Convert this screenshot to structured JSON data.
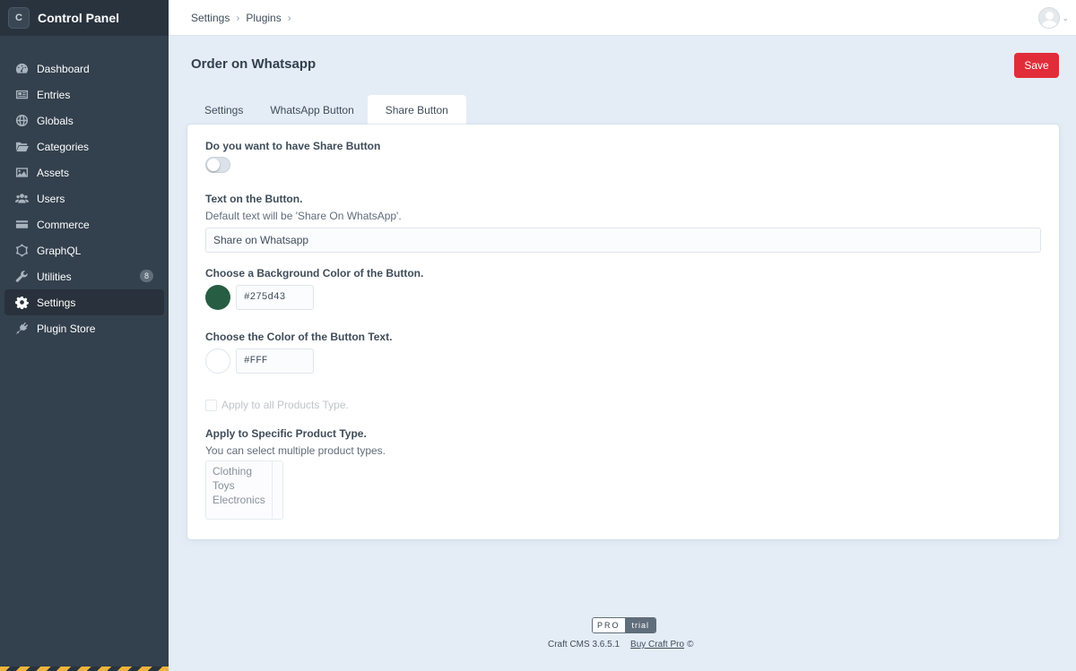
{
  "app": {
    "name": "Control Panel",
    "logo_letter": "C"
  },
  "nav": {
    "items": [
      {
        "label": "Dashboard",
        "icon": "gauge-icon"
      },
      {
        "label": "Entries",
        "icon": "newspaper-icon"
      },
      {
        "label": "Globals",
        "icon": "globe-icon"
      },
      {
        "label": "Categories",
        "icon": "folder-icon"
      },
      {
        "label": "Assets",
        "icon": "image-icon"
      },
      {
        "label": "Users",
        "icon": "users-icon"
      },
      {
        "label": "Commerce",
        "icon": "credit-card-icon"
      },
      {
        "label": "GraphQL",
        "icon": "graphql-icon"
      },
      {
        "label": "Utilities",
        "icon": "wrench-icon",
        "badge": "8"
      },
      {
        "label": "Settings",
        "icon": "gear-icon",
        "selected": true
      },
      {
        "label": "Plugin Store",
        "icon": "plug-icon"
      }
    ]
  },
  "breadcrumbs": [
    "Settings",
    "Plugins"
  ],
  "page": {
    "title": "Order on Whatsapp",
    "save_label": "Save"
  },
  "tabs": [
    {
      "label": "Settings"
    },
    {
      "label": "WhatsApp Button"
    },
    {
      "label": "Share Button",
      "selected": true
    }
  ],
  "form": {
    "share_toggle": {
      "label": "Do you want to have Share Button",
      "on": false
    },
    "button_text": {
      "label": "Text on the Button.",
      "instructions": "Default text will be 'Share On WhatsApp'.",
      "value": "Share on Whatsapp"
    },
    "bg_color": {
      "label": "Choose a Background Color of the Button.",
      "value": "#275d43"
    },
    "text_color": {
      "label": "Choose the Color of the Button Text.",
      "value": "#FFF"
    },
    "apply_all": {
      "label": "Apply to all Products Type.",
      "checked": false,
      "disabled": true
    },
    "product_types": {
      "label": "Apply to Specific Product Type.",
      "instructions": "You can select multiple product types.",
      "options": [
        "Clothing",
        "Toys",
        "Electronics"
      ]
    }
  },
  "footer": {
    "edition_pro": "PRO",
    "edition_trial": "trial",
    "version": "Craft CMS 3.6.5.1",
    "buy_link": "Buy Craft Pro",
    "copyright_symbol": "©"
  },
  "colors": {
    "sidebar": "#33404d",
    "save": "#e12d39",
    "swatch_bg": "#275d43",
    "swatch_text": "#ffffff"
  }
}
